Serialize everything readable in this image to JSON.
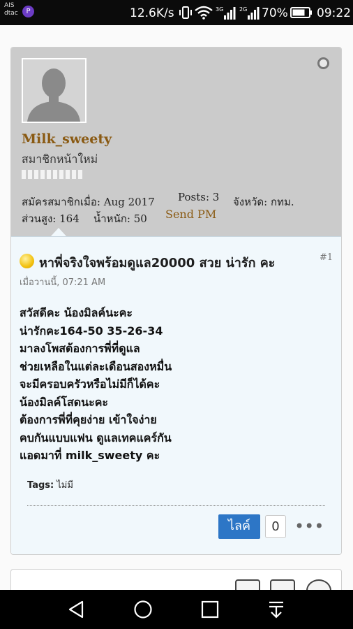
{
  "status_bar": {
    "carrier_1": "AIS",
    "carrier_2": "dtac",
    "app_badge": "P",
    "net_speed": "12.6K/s",
    "network_1": "3G",
    "network_2": "2G",
    "battery": "70%",
    "time": "09:22"
  },
  "user": {
    "username": "Milk_sweety",
    "title": "สมาชิกหน้าใหม่",
    "joined": "สมัครสมาชิกเมื่อ: Aug 2017",
    "posts": "Posts: 3",
    "province": "จังหวัด: กทม.",
    "height": "ส่วนสูง: 164",
    "weight": "น้ำหนัก: 50",
    "send_pm": "Send PM"
  },
  "post": {
    "title": "หาพี่จริงใจพร้อมดูแล20000 สวย น่ารัก คะ",
    "number": "#1",
    "date": "เมื่อวานนี้, 07:21 AM",
    "lines": [
      "สวัสดีคะ น้องมิลค์นะคะ",
      "น่ารักคะ164-50 35-26-34",
      "มาลงโพสต้องการพี่ที่ดูแล",
      "ช่วยเหลือในแต่ละเดือนสองหมื่น",
      "จะมีครอบครัวหรือไม่มีก็ได้คะ",
      "น้องมิลค์โสดนะคะ",
      "ต้องการพี่ที่คุยง่าย เข้าใจง่าย",
      "คบกันแบบแฟน ดูแลเทคแคร์กัน",
      "แอดมาที่ milk_sweety คะ"
    ],
    "tags_label": "Tags:",
    "tags_value": "ไม่มี",
    "like_label": "ไลค์",
    "like_count": "0",
    "more": "•••"
  }
}
